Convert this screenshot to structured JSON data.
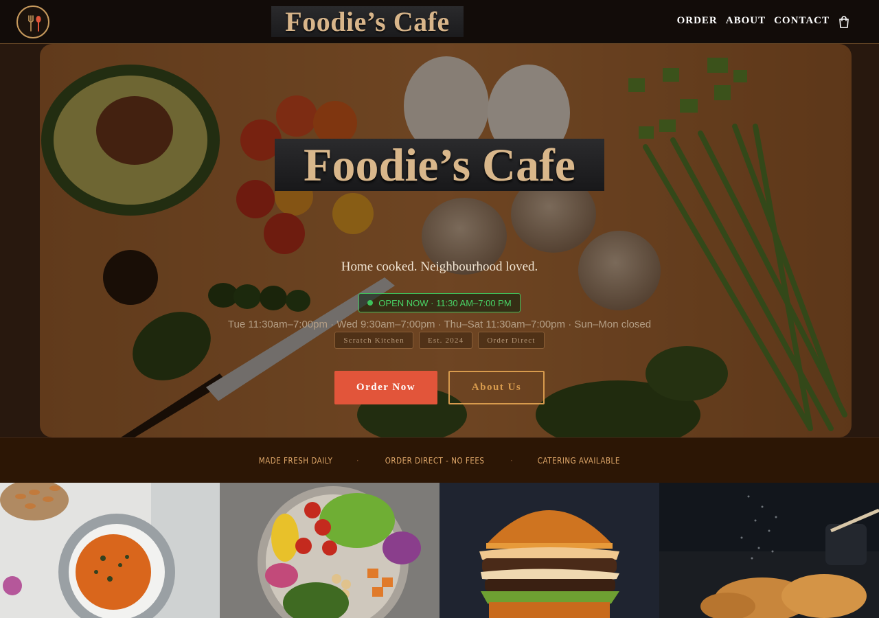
{
  "header": {
    "wordmark": "Foodie’s Cafe",
    "nav": [
      "ORDER",
      "ABOUT",
      "CONTACT"
    ]
  },
  "hero": {
    "wordmark": "Foodie’s Cafe",
    "tagline": "Home cooked. Neighbourhood loved.",
    "status": "OPEN NOW · 11:30 AM–7:00 PM",
    "hours": "Tue 11:30am–7:00pm · Wed 9:30am–7:00pm · Thu–Sat 11:30am–7:00pm · Sun–Mon closed",
    "chips": [
      "Scratch Kitchen",
      "Est. 2024",
      "Order Direct"
    ],
    "order_button": "Order Now",
    "about_button": "About Us"
  },
  "strip": {
    "items": [
      "MADE FRESH DAILY",
      "ORDER DIRECT - NO FEES",
      "CATERING AVAILABLE"
    ],
    "separator": "·"
  },
  "tiles": [
    "soup-bowl",
    "salad-bowl",
    "burger",
    "croissants"
  ],
  "colors": {
    "accent": "#e2553a",
    "gold": "#d89b4d",
    "open_green": "#3ec25b",
    "strip_bg": "#2c1605",
    "header_bg": "#120c09"
  },
  "icons": [
    "fork-spoon-logo-icon",
    "shopping-bag-icon"
  ]
}
